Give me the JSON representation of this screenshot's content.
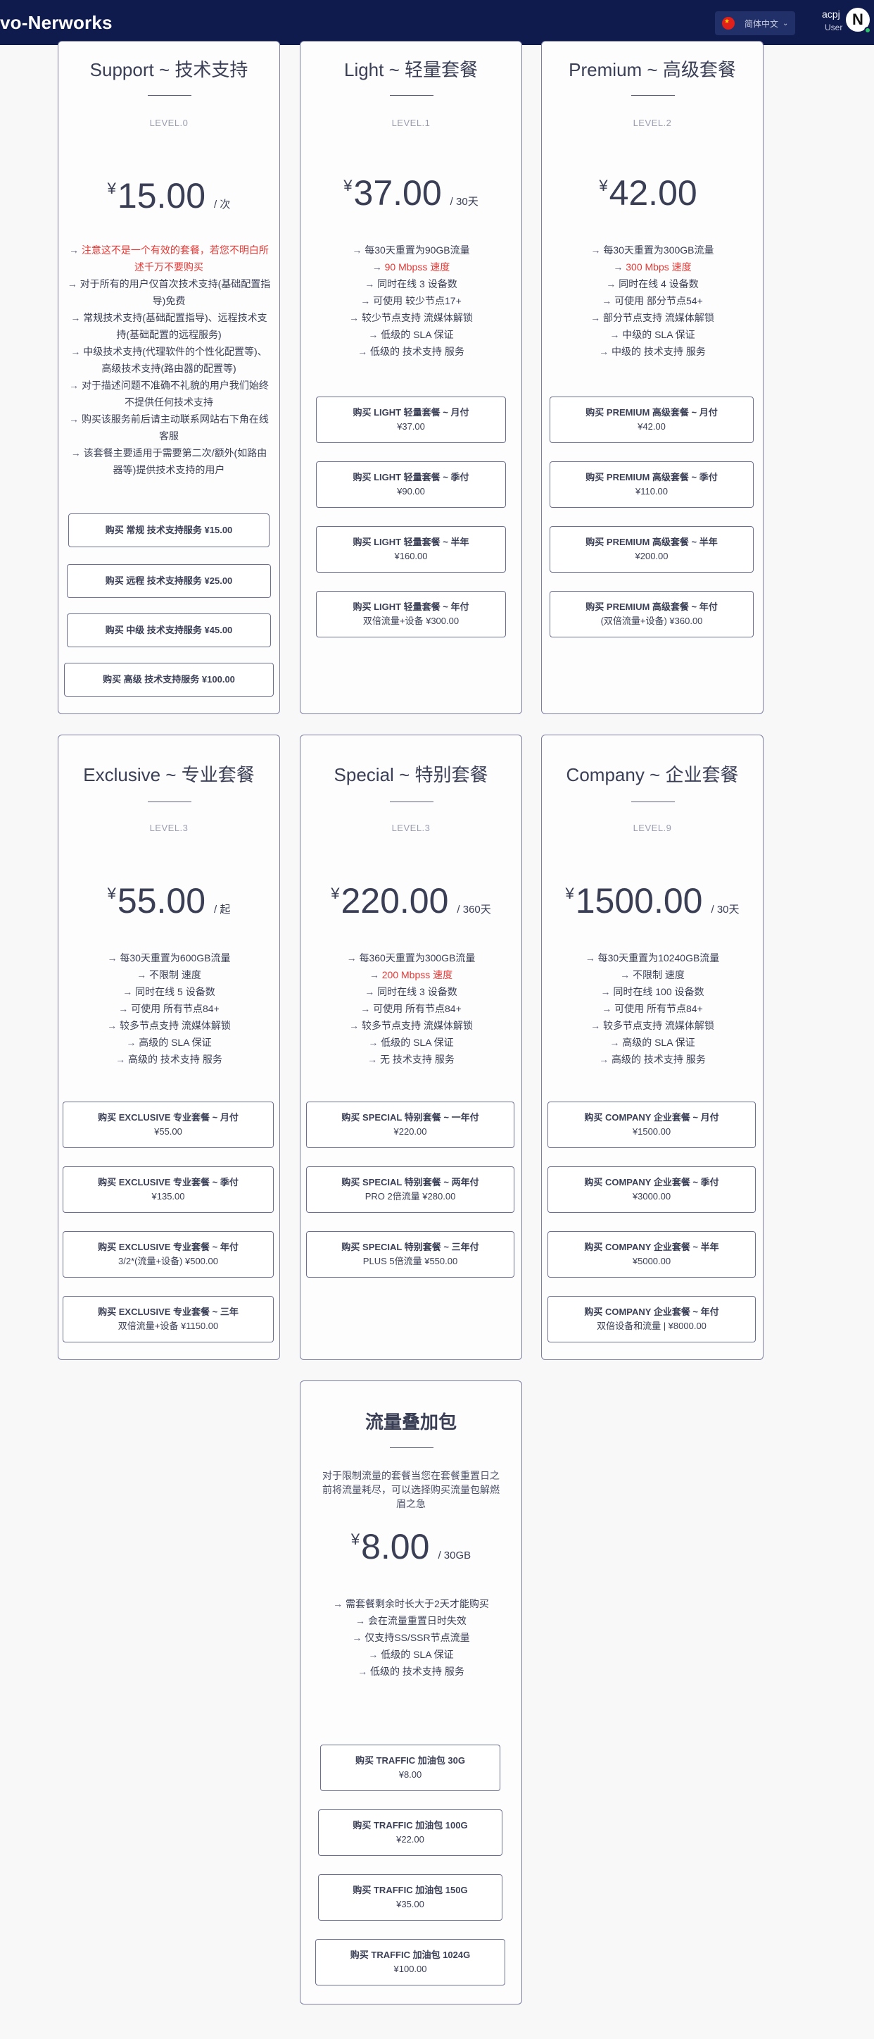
{
  "header": {
    "brand": "vo-Nerworks",
    "language": "简体中文",
    "user_name": "acpj",
    "user_role": "User",
    "avatar_letter": "N"
  },
  "cards": {
    "support": {
      "title": "Support ~ 技术支持",
      "level": "LEVEL.0",
      "currency": "¥",
      "price": "15.00",
      "period": "/ 次",
      "features": [
        "注意这不是一个有效的套餐，若您不明白所述千万不要购买",
        "对于所有的用户仅首次技术支持(基础配置指导)免费",
        "常规技术支持(基础配置指导)、远程技术支持(基础配置的远程服务)",
        "中级技术支持(代理软件的个性化配置等)、高级技术支持(路由器的配置等)",
        "对于描述问题不准确不礼貌的用户我们始终不提供任何技术支持",
        "购买该服务前后请主动联系网站右下角在线客服",
        "该套餐主要适用于需要第二次/额外(如路由器等)提供技术支持的用户"
      ],
      "buttons": [
        {
          "label": "购买 常规 技术支持服务 ¥15.00"
        },
        {
          "label": "购买 远程 技术支持服务 ¥25.00"
        },
        {
          "label": "购买 中级 技术支持服务 ¥45.00"
        },
        {
          "label": "购买 高级 技术支持服务 ¥100.00"
        }
      ]
    },
    "light": {
      "title": "Light ~ 轻量套餐",
      "level": "LEVEL.1",
      "currency": "¥",
      "price": "37.00",
      "period": "/ 30天",
      "features": [
        "每30天重置为90GB流量",
        "90 Mbpss 速度",
        "同时在线 3 设备数",
        "可使用 较少节点17+",
        "较少节点支持 流媒体解锁",
        "低级的 SLA 保证",
        "低级的 技术支持 服务"
      ],
      "buttons": [
        {
          "label": "购买 LIGHT 轻量套餐 ~ 月付",
          "sub": "¥37.00"
        },
        {
          "label": "购买 LIGHT 轻量套餐 ~ 季付",
          "sub": "¥90.00"
        },
        {
          "label": "购买 LIGHT 轻量套餐 ~ 半年",
          "sub": "¥160.00"
        },
        {
          "label": "购买 LIGHT 轻量套餐 ~ 年付",
          "sub": "双倍流量+设备 ¥300.00"
        }
      ]
    },
    "premium": {
      "title": "Premium ~ 高级套餐",
      "level": "LEVEL.2",
      "currency": "¥",
      "price": "42.00",
      "period": "",
      "features": [
        "每30天重置为300GB流量",
        "300 Mbps 速度",
        "同时在线 4 设备数",
        "可使用 部分节点54+",
        "部分节点支持 流媒体解锁",
        "中级的 SLA 保证",
        "中级的 技术支持 服务"
      ],
      "buttons": [
        {
          "label": "购买 PREMIUM 高级套餐 ~ 月付",
          "sub": "¥42.00"
        },
        {
          "label": "购买 PREMIUM 高级套餐 ~ 季付",
          "sub": "¥110.00"
        },
        {
          "label": "购买 PREMIUM 高级套餐 ~ 半年",
          "sub": "¥200.00"
        },
        {
          "label": "购买 PREMIUM 高级套餐 ~ 年付",
          "sub": "(双倍流量+设备) ¥360.00"
        }
      ]
    },
    "exclusive": {
      "title": "Exclusive ~ 专业套餐",
      "level": "LEVEL.3",
      "currency": "¥",
      "price": "55.00",
      "period": "/ 起",
      "features": [
        "每30天重置为600GB流量",
        "不限制 速度",
        "同时在线 5 设备数",
        "可使用 所有节点84+",
        "较多节点支持 流媒体解锁",
        "高级的 SLA 保证",
        "高级的 技术支持 服务"
      ],
      "buttons": [
        {
          "label": "购买 EXCLUSIVE 专业套餐 ~ 月付",
          "sub": "¥55.00"
        },
        {
          "label": "购买 EXCLUSIVE 专业套餐 ~ 季付",
          "sub": "¥135.00"
        },
        {
          "label": "购买 EXCLUSIVE 专业套餐 ~ 年付",
          "sub": "3/2*(流量+设备) ¥500.00"
        },
        {
          "label": "购买 EXCLUSIVE 专业套餐 ~ 三年",
          "sub": "双倍流量+设备 ¥1150.00"
        }
      ]
    },
    "special": {
      "title": "Special ~ 特别套餐",
      "level": "LEVEL.3",
      "currency": "¥",
      "price": "220.00",
      "period": "/ 360天",
      "features": [
        "每360天重置为300GB流量",
        "200 Mbpss 速度",
        "同时在线 3 设备数",
        "可使用 所有节点84+",
        "较多节点支持 流媒体解锁",
        "低级的 SLA 保证",
        "无 技术支持 服务"
      ],
      "buttons": [
        {
          "label": "购买 SPECIAL 特别套餐 ~ 一年付",
          "sub": "¥220.00"
        },
        {
          "label": "购买 SPECIAL 特别套餐 ~ 两年付",
          "sub": "PRO 2倍流量 ¥280.00"
        },
        {
          "label": "购买 SPECIAL 特别套餐 ~ 三年付",
          "sub": "PLUS 5倍流量 ¥550.00"
        }
      ]
    },
    "company": {
      "title": "Company ~ 企业套餐",
      "level": "LEVEL.9",
      "currency": "¥",
      "price": "1500.00",
      "period": "/ 30天",
      "features": [
        "每30天重置为10240GB流量",
        "不限制 速度",
        "同时在线 100 设备数",
        "可使用 所有节点84+",
        "较多节点支持 流媒体解锁",
        "高级的 SLA 保证",
        "高级的 技术支持 服务"
      ],
      "buttons": [
        {
          "label": "购买 COMPANY 企业套餐 ~ 月付",
          "sub": "¥1500.00"
        },
        {
          "label": "购买 COMPANY 企业套餐 ~ 季付",
          "sub": "¥3000.00"
        },
        {
          "label": "购买 COMPANY 企业套餐 ~ 半年",
          "sub": "¥5000.00"
        },
        {
          "label": "购买 COMPANY 企业套餐 ~ 年付",
          "sub": "双倍设备和流量 | ¥8000.00"
        }
      ]
    },
    "traffic": {
      "title": "流量叠加包",
      "intro": "对于限制流量的套餐当您在套餐重置日之前将流量耗尽，可以选择购买流量包解燃眉之急",
      "currency": "¥",
      "price": "8.00",
      "period": "/ 30GB",
      "features": [
        "需套餐剩余时长大于2天才能购买",
        "会在流量重置日时失效",
        "仅支持SS/SSR节点流量",
        "低级的 SLA 保证",
        "低级的 技术支持 服务"
      ],
      "buttons": [
        {
          "label": "购买 TRAFFIC 加油包 30G",
          "sub": "¥8.00"
        },
        {
          "label": "购买 TRAFFIC 加油包 100G",
          "sub": "¥22.00"
        },
        {
          "label": "购买 TRAFFIC 加油包 150G",
          "sub": "¥35.00"
        },
        {
          "label": "购买 TRAFFIC 加油包 1024G",
          "sub": "¥100.00"
        }
      ]
    }
  },
  "colors": {
    "header_bg": "#0f1a4d",
    "accent_red": "#e53935",
    "card_border": "#7c7fa0",
    "text": "#3a3f55"
  }
}
